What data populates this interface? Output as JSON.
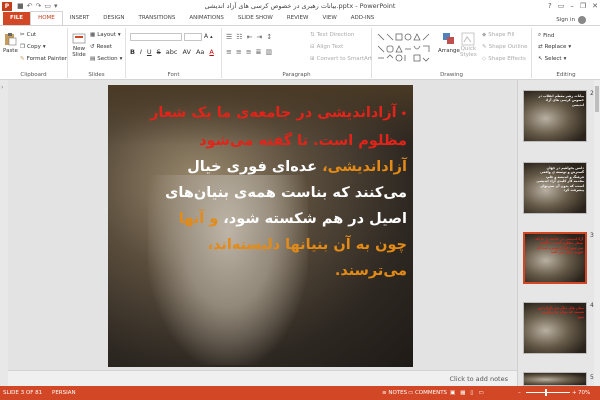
{
  "window": {
    "title": "بیانات رهبری در خصوص کرسی های آزاد اندیشی.pptx - PowerPoint",
    "help": "?",
    "minimize": "–",
    "restore": "❐",
    "close": "✕"
  },
  "tabs": [
    "FILE",
    "HOME",
    "INSERT",
    "DESIGN",
    "TRANSITIONS",
    "ANIMATIONS",
    "SLIDE SHOW",
    "REVIEW",
    "VIEW",
    "ADD-INS"
  ],
  "active_tab": "HOME",
  "account": {
    "sign_in": "Sign in"
  },
  "ribbon": {
    "clipboard": {
      "label": "Clipboard",
      "paste": "Paste",
      "cut": "Cut",
      "copy": "Copy",
      "format_painter": "Format Painter"
    },
    "slides": {
      "label": "Slides",
      "new_slide": "New",
      "new_slide2": "Slide",
      "layout": "Layout",
      "reset": "Reset",
      "section": "Section"
    },
    "font": {
      "label": "Font",
      "bold": "B",
      "italic": "I",
      "underline": "U",
      "strike": "S",
      "shadow": "abc",
      "spacing": "AV",
      "case": "Aa",
      "color": "A"
    },
    "paragraph": {
      "label": "Paragraph",
      "text_direction": "Text Direction",
      "align_text": "Align Text",
      "convert": "Convert to SmartArt"
    },
    "drawing": {
      "label": "Drawing",
      "arrange": "Arrange",
      "quick_styles": "Quick",
      "quick_styles2": "Styles",
      "shape_fill": "Shape Fill",
      "shape_outline": "Shape Outline",
      "shape_effects": "Shape Effects"
    },
    "editing": {
      "label": "Editing",
      "find": "Find",
      "replace": "Replace",
      "select": "Select"
    }
  },
  "slide": {
    "bullet": "•",
    "line1": "آزاداندیشی در جامعه‌ی ما یک شعار",
    "line2_red": "مظلوم است. تا گفته می‌شود",
    "line3_orange": "آزاداندیشی،",
    "line3_white": " عده‌ای فوری خیال",
    "line4_white": "می‌کنند که بناست همه‌ی بنیان‌های",
    "line5_white": "اصیل در هم شکسته شود،",
    "line5_orange": " و آنها",
    "line6_orange": "چون به آن بنیانها دلبسته‌اند،",
    "line7_orange": "می‌ترسند."
  },
  "notes_placeholder": "Click to add notes",
  "thumbnails": [
    {
      "num": "2",
      "text": "بیانات رهبر معظم انقلاب در خصوص کرسی های آزاد اندیشی",
      "red": false
    },
    {
      "num": "",
      "text": "دانش بخواهیم در جهان گسترش و توسعه ی واقعی فرهنگ و اندیشه و علم، مقدمه کار کلیدی آزاد اندیشی است، که بدون آن نمی‌توان پیشرفت کرد",
      "red": false
    },
    {
      "num": "3",
      "text": "آزاداندیشی در جامعه ی ما یک شعار مظلوم است. تا گفته می شود آزاداندیشی، عده ای فوری خیال می کنند",
      "red": true
    },
    {
      "num": "4",
      "text": "بنیان های دیگر هم نگران این هستند که بنیان ها شکسته شود",
      "red": true
    },
    {
      "num": "5",
      "text": "",
      "red": false
    }
  ],
  "status": {
    "slide_of": "SLIDE 3 OF 81",
    "language": "PERSIAN",
    "notes": "NOTES",
    "comments": "COMMENTS",
    "zoom": "70%"
  },
  "colors": {
    "accent": "#D24726",
    "slide_red": "#E3231A",
    "slide_orange": "#E38B16",
    "slide_white": "#FFFFFF"
  }
}
